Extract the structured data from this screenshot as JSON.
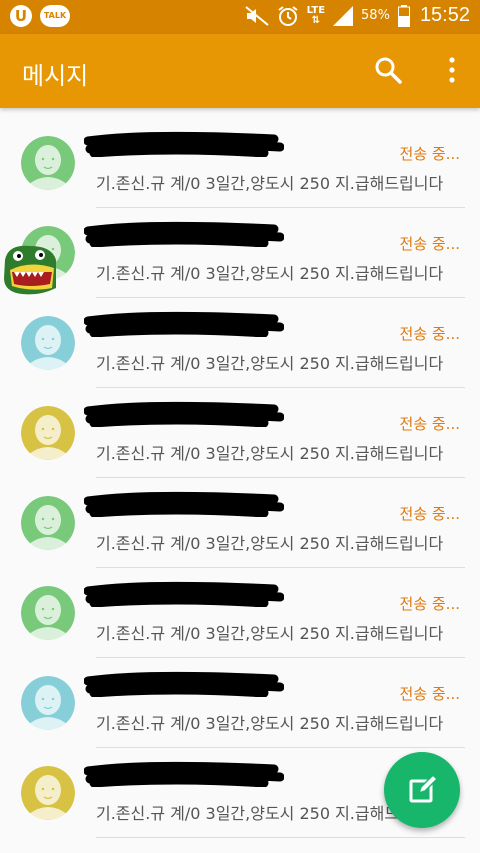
{
  "status_bar": {
    "lte": "LTE",
    "battery": "58%",
    "time": "15:52",
    "talk_badge": "TALK",
    "u_badge": "U"
  },
  "app_bar": {
    "title": "메시지",
    "search_icon": "search-icon",
    "more_icon": "more-vertical-icon"
  },
  "colors": {
    "status_bar": "#d68400",
    "app_bar": "#e89704",
    "status_text": "#e07a10",
    "fab": "#17b66a",
    "avatar_green": "#79c97b",
    "avatar_blue": "#86cfd9",
    "avatar_yellow": "#d8c243"
  },
  "threads": [
    {
      "avatar_color": "green",
      "name": "",
      "status": "전송 중...",
      "preview": "기.존신.규 계/0 3일간,양도시 250 지.급해드립니다"
    },
    {
      "avatar_color": "green",
      "name": "",
      "status": "전송 중...",
      "preview": "기.존신.규 계/0 3일간,양도시 250 지.급해드립니다"
    },
    {
      "avatar_color": "blue",
      "name": "",
      "status": "전송 중...",
      "preview": "기.존신.규 계/0 3일간,양도시 250 지.급해드립니다"
    },
    {
      "avatar_color": "yellow",
      "name": "",
      "status": "전송 중...",
      "preview": "기.존신.규 계/0 3일간,양도시 250 지.급해드립니다"
    },
    {
      "avatar_color": "green",
      "name": "",
      "status": "전송 중...",
      "preview": "기.존신.규 계/0 3일간,양도시 250 지.급해드립니다"
    },
    {
      "avatar_color": "green",
      "name": "",
      "status": "전송 중...",
      "preview": "기.존신.규 계/0 3일간,양도시 250 지.급해드립니다"
    },
    {
      "avatar_color": "blue",
      "name": "",
      "status": "전송 중...",
      "preview": "기.존신.규 계/0 3일간,양도시 250 지.급해드립니다"
    },
    {
      "avatar_color": "yellow",
      "name": "",
      "status": "",
      "preview": "기.존신.규 계/0 3일간,양도시 250 지.급해드립니다"
    }
  ],
  "fab": {
    "icon": "compose-icon"
  }
}
